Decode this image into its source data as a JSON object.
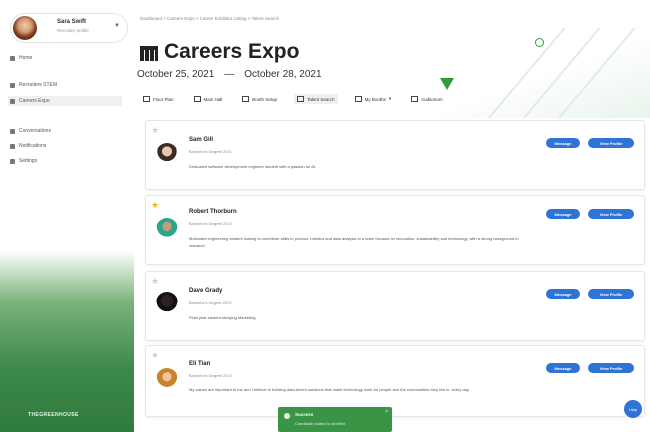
{
  "sidebar": {
    "user_name": "Sara Swift",
    "user_role": "Recruiter profile",
    "items": [
      {
        "label": "Home",
        "icon": "home-icon"
      },
      {
        "label": "Recruiters STEM",
        "icon": "briefcase-icon"
      },
      {
        "label": "Careers Expo",
        "icon": "calendar-icon"
      },
      {
        "label": "Conversations",
        "icon": "chat-icon"
      },
      {
        "label": "Notifications",
        "icon": "bell-icon"
      },
      {
        "label": "Settings",
        "icon": "gear-icon"
      }
    ],
    "footer": "THEGREENHOUSE"
  },
  "breadcrumb": "Dashboard  >  Careers Expo  >  Career Exhibitor Listing  >  Talent Search",
  "event": {
    "title": "Careers Expo",
    "start": "October 25, 2021",
    "dash": "—",
    "end": "October 28, 2021"
  },
  "toolbar": [
    {
      "label": "Floor Plan",
      "icon": "map-icon"
    },
    {
      "label": "Main Hall",
      "icon": "hall-icon"
    },
    {
      "label": "Booth Setup",
      "icon": "booth-icon"
    },
    {
      "label": "Talent Search",
      "icon": "search-icon"
    },
    {
      "label": "My Booths",
      "icon": "booth-list-icon"
    },
    {
      "label": "Auditorium",
      "icon": "auditorium-icon"
    }
  ],
  "candidates": [
    {
      "name": "Sam Gill",
      "degree": "Bachelor's Degree 2021",
      "bio": "Dedicated software development engineer student with a passion for AI.",
      "starred": false
    },
    {
      "name": "Robert Thorburn",
      "degree": "Bachelor's Degree 2022",
      "bio": "Motivated engineering student looking to contribute skills in product, robotics and data analysis to a team focused on innovation, sustainability and technology, with a strong background in research.",
      "starred": true
    },
    {
      "name": "Dave Grady",
      "degree": "Bachelor's Degree 2021",
      "bio": "Final year student studying Marketing.",
      "starred": false
    },
    {
      "name": "Eli Tian",
      "degree": "Bachelor's Degree 2022",
      "bio": "My values are important to me and I believe in building data-driven solutions that make technology work for people and the communities they live in, every day.",
      "starred": false
    }
  ],
  "buttons": {
    "message": "Message",
    "view_profile": "View Profile"
  },
  "toast": {
    "title": "Success",
    "message": "Candidate added to shortlist"
  },
  "fab_label": "Help",
  "colors": {
    "primary": "#2f73d4",
    "accent_green": "#3a9446",
    "star": "#f3b814"
  }
}
